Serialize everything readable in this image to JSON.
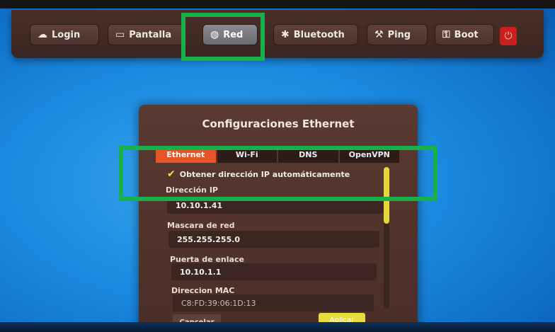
{
  "toolbar": {
    "items": [
      {
        "label": "Login",
        "icon": "cloud-icon"
      },
      {
        "label": "Pantalla",
        "icon": "monitor-icon"
      },
      {
        "label": "Red",
        "icon": "globe-icon"
      },
      {
        "label": "Bluetooth",
        "icon": "bluetooth-icon"
      },
      {
        "label": "Ping",
        "icon": "wrench-icon"
      },
      {
        "label": "Boot",
        "icon": "key-icon"
      }
    ],
    "active": "Red",
    "power_icon": "power-icon",
    "power_color": "#c81f1f"
  },
  "dialog": {
    "title": "Configuraciones Ethernet",
    "tabs": [
      "Ethernet",
      "Wi-Fi",
      "DNS",
      "OpenVPN"
    ],
    "active_tab": "Ethernet",
    "auto_ip_label": "Obtener dirección IP automáticamente",
    "auto_ip_checked": true,
    "fields": {
      "ip": {
        "label": "Dirección IP",
        "value": "10.10.1.41"
      },
      "mask": {
        "label": "Mascara de red",
        "value": "255.255.255.0"
      },
      "gateway": {
        "label": "Puerta de enlace",
        "value": "10.10.1.1"
      },
      "mac": {
        "label": "Direccion MAC",
        "value": "C8:FD:39:06:1D:13"
      }
    },
    "cancel_label": "Cancelar",
    "apply_label": "Aplicar",
    "accent_color": "#e8542a",
    "apply_color": "#e6dc3c"
  },
  "highlight_color": "#18b04a"
}
